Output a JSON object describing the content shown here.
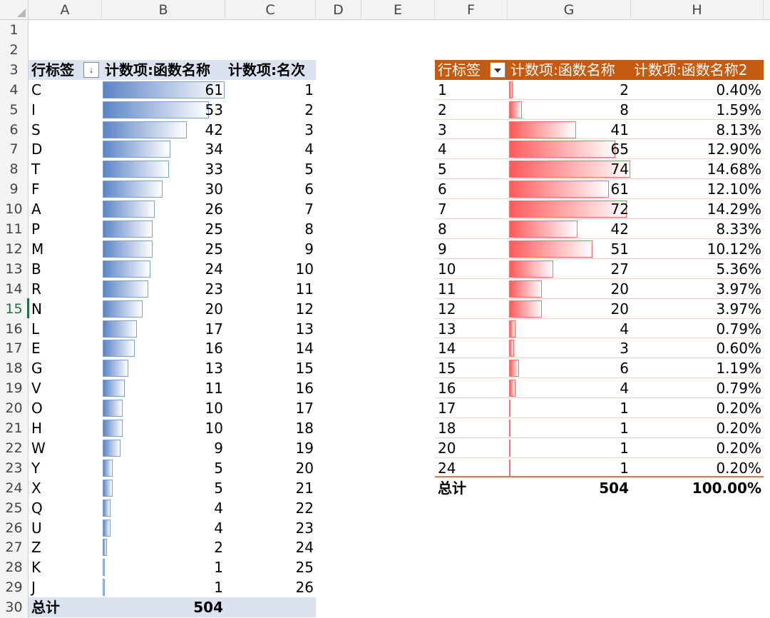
{
  "columns": [
    "A",
    "B",
    "C",
    "D",
    "E",
    "F",
    "G",
    "H"
  ],
  "rows": [
    "1",
    "2",
    "3",
    "4",
    "5",
    "6",
    "7",
    "8",
    "9",
    "10",
    "11",
    "12",
    "13",
    "14",
    "15",
    "16",
    "17",
    "18",
    "19",
    "20",
    "21",
    "22",
    "23",
    "24",
    "25",
    "26",
    "27",
    "28",
    "29",
    "30"
  ],
  "selected_row": "15",
  "pivot1": {
    "header": {
      "label": "行标签",
      "count": "计数项:函数名称",
      "rank": "计数项:名次"
    },
    "sort_icon": "sort-descending-icon",
    "bar_color": "#5b84c6",
    "items": [
      {
        "label": "C",
        "count": 61,
        "rank": 1
      },
      {
        "label": "I",
        "count": 53,
        "rank": 2
      },
      {
        "label": "S",
        "count": 42,
        "rank": 3
      },
      {
        "label": "D",
        "count": 34,
        "rank": 4
      },
      {
        "label": "T",
        "count": 33,
        "rank": 5
      },
      {
        "label": "F",
        "count": 30,
        "rank": 6
      },
      {
        "label": "A",
        "count": 26,
        "rank": 7
      },
      {
        "label": "P",
        "count": 25,
        "rank": 8
      },
      {
        "label": "M",
        "count": 25,
        "rank": 9
      },
      {
        "label": "B",
        "count": 24,
        "rank": 10
      },
      {
        "label": "R",
        "count": 23,
        "rank": 11
      },
      {
        "label": "N",
        "count": 20,
        "rank": 12
      },
      {
        "label": "L",
        "count": 17,
        "rank": 13
      },
      {
        "label": "E",
        "count": 16,
        "rank": 14
      },
      {
        "label": "G",
        "count": 13,
        "rank": 15
      },
      {
        "label": "V",
        "count": 11,
        "rank": 16
      },
      {
        "label": "O",
        "count": 10,
        "rank": 17
      },
      {
        "label": "H",
        "count": 10,
        "rank": 18
      },
      {
        "label": "W",
        "count": 9,
        "rank": 19
      },
      {
        "label": "Y",
        "count": 5,
        "rank": 20
      },
      {
        "label": "X",
        "count": 5,
        "rank": 21
      },
      {
        "label": "Q",
        "count": 4,
        "rank": 22
      },
      {
        "label": "U",
        "count": 4,
        "rank": 23
      },
      {
        "label": "Z",
        "count": 2,
        "rank": 24
      },
      {
        "label": "K",
        "count": 1,
        "rank": 25
      },
      {
        "label": "J",
        "count": 1,
        "rank": 26
      }
    ],
    "total": {
      "label": "总计",
      "count": "504"
    }
  },
  "pivot2": {
    "header": {
      "label": "行标签",
      "count": "计数项:函数名称",
      "pct": "计数项:函数名称2"
    },
    "filter_icon": "dropdown-arrow-icon",
    "header_color": "#c55a11",
    "bar_color": "#ff5a5a",
    "items": [
      {
        "label": "1",
        "count": 2,
        "pct": "0.40%"
      },
      {
        "label": "2",
        "count": 8,
        "pct": "1.59%"
      },
      {
        "label": "3",
        "count": 41,
        "pct": "8.13%"
      },
      {
        "label": "4",
        "count": 65,
        "pct": "12.90%"
      },
      {
        "label": "5",
        "count": 74,
        "pct": "14.68%"
      },
      {
        "label": "6",
        "count": 61,
        "pct": "12.10%"
      },
      {
        "label": "7",
        "count": 72,
        "pct": "14.29%"
      },
      {
        "label": "8",
        "count": 42,
        "pct": "8.33%"
      },
      {
        "label": "9",
        "count": 51,
        "pct": "10.12%"
      },
      {
        "label": "10",
        "count": 27,
        "pct": "5.36%"
      },
      {
        "label": "11",
        "count": 20,
        "pct": "3.97%"
      },
      {
        "label": "12",
        "count": 20,
        "pct": "3.97%"
      },
      {
        "label": "13",
        "count": 4,
        "pct": "0.79%"
      },
      {
        "label": "14",
        "count": 3,
        "pct": "0.60%"
      },
      {
        "label": "15",
        "count": 6,
        "pct": "1.19%"
      },
      {
        "label": "16",
        "count": 4,
        "pct": "0.79%"
      },
      {
        "label": "17",
        "count": 1,
        "pct": "0.20%"
      },
      {
        "label": "18",
        "count": 1,
        "pct": "0.20%"
      },
      {
        "label": "20",
        "count": 1,
        "pct": "0.20%"
      },
      {
        "label": "24",
        "count": 1,
        "pct": "0.20%"
      }
    ],
    "total": {
      "label": "总计",
      "count": "504",
      "pct": "100.00%"
    }
  }
}
